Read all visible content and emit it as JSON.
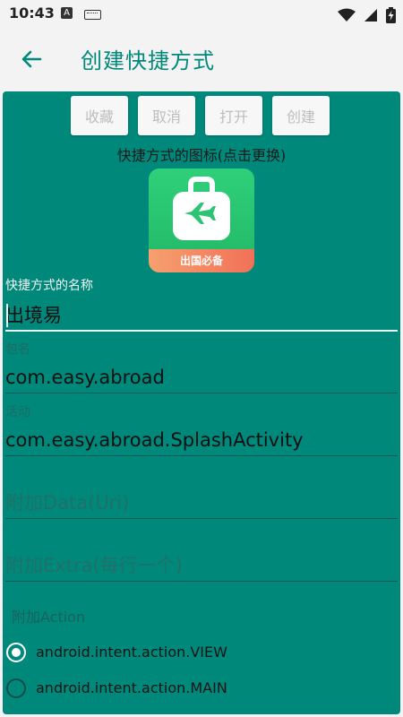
{
  "status": {
    "time": "10:43",
    "badge": "A"
  },
  "header": {
    "title": "创建快捷方式"
  },
  "toolbar": {
    "favorite_label": "收藏",
    "cancel_label": "取消",
    "open_label": "打开",
    "create_label": "创建"
  },
  "icon_section": {
    "caption": "快捷方式的图标(点击更换)",
    "app_icon_text": "出国必备"
  },
  "form": {
    "name_label": "快捷方式的名称",
    "name_value": "出境易",
    "package_label": "包名",
    "package_value": "com.easy.abroad",
    "activity_label": "活动",
    "activity_value": "com.easy.abroad.SplashActivity",
    "data_placeholder": "附加Data(Uri)",
    "extra_placeholder": "附加Extra(每行一个)"
  },
  "actions": {
    "section_label": "附加Action",
    "options": [
      {
        "label": "android.intent.action.VIEW",
        "checked": true
      },
      {
        "label": "android.intent.action.MAIN",
        "checked": false
      }
    ]
  },
  "colors": {
    "accent": "#00897b",
    "background": "#f3f3f3",
    "button_bg": "#f7f7f7",
    "button_text": "#bdbdbd"
  }
}
